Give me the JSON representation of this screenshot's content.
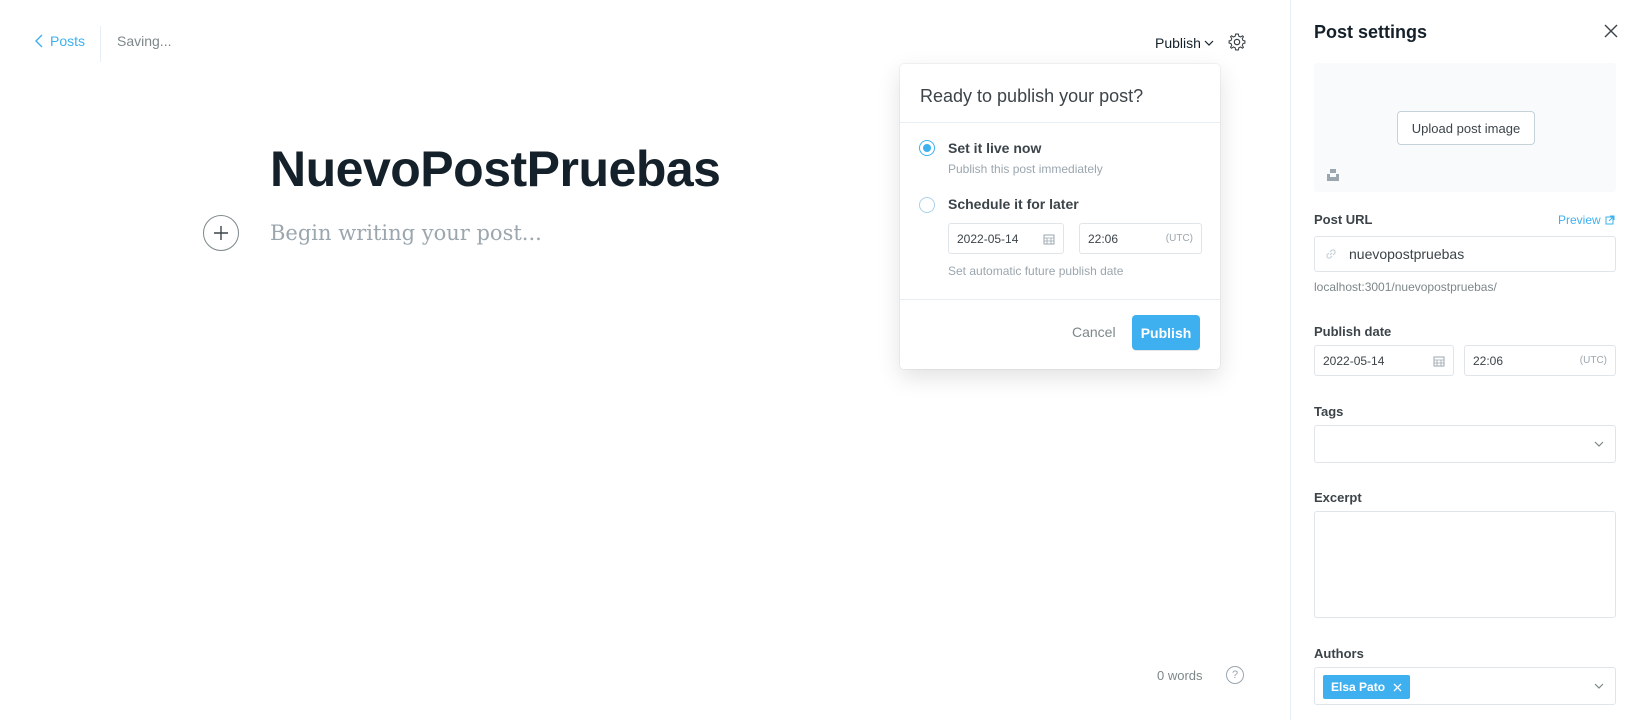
{
  "header": {
    "back_label": "Posts",
    "status": "Saving...",
    "publish_menu_label": "Publish"
  },
  "editor": {
    "title": "NuevoPostPruebas",
    "body_placeholder": "Begin writing your post...",
    "word_count": "0 words",
    "help_glyph": "?"
  },
  "publish_popover": {
    "title": "Ready to publish your post?",
    "option_now_label": "Set it live now",
    "option_now_sub": "Publish this post immediately",
    "option_later_label": "Schedule it for later",
    "date": "2022-05-14",
    "time": "22:06",
    "tz": "(UTC)",
    "later_hint": "Set automatic future publish date",
    "cancel_label": "Cancel",
    "publish_label": "Publish",
    "selected_option": "now"
  },
  "settings": {
    "title": "Post settings",
    "upload_label": "Upload post image",
    "post_url_label": "Post URL",
    "preview_label": "Preview",
    "slug": "nuevopostpruebas",
    "url_hint": "localhost:3001/nuevopostpruebas/",
    "publish_date_label": "Publish date",
    "date": "2022-05-14",
    "time": "22:06",
    "tz": "(UTC)",
    "tags_label": "Tags",
    "excerpt_label": "Excerpt",
    "authors_label": "Authors",
    "authors": [
      "Elsa Pato"
    ]
  },
  "colors": {
    "accent": "#3eb0ef",
    "text": "#15212a",
    "muted": "#7d878a"
  }
}
